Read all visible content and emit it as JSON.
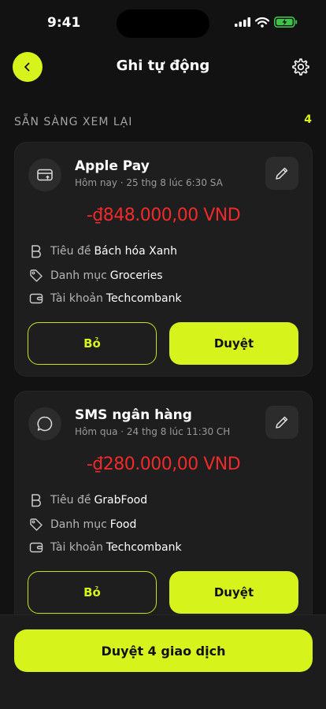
{
  "status_bar": {
    "time": "9:41"
  },
  "header": {
    "title": "Ghi tự động"
  },
  "section": {
    "title": "SẴN SÀNG XEM LẠI",
    "count": "4"
  },
  "labels": {
    "title": "Tiêu đề",
    "category": "Danh mục",
    "account": "Tài khoản",
    "skip": "Bỏ",
    "approve": "Duyệt"
  },
  "cards": [
    {
      "source": "Apple Pay",
      "date": "Hôm nay · 25 thg 8 lúc 6:30 SA",
      "amount": "-₫848.000,00 VND",
      "title": "Bách hóa Xanh",
      "category": "Groceries",
      "account": "Techcombank"
    },
    {
      "source": "SMS ngân hàng",
      "date": "Hôm qua · 24 thg 8 lúc 11:30 CH",
      "amount": "-₫280.000,00 VND",
      "title": "GrabFood",
      "category": "Food",
      "account": "Techcombank"
    }
  ],
  "footer": {
    "approve_all": "Duyệt 4 giao dịch"
  },
  "colors": {
    "accent": "#d6f31b",
    "negative": "#f02a2a",
    "background": "#121212",
    "card": "#1e1e1e"
  }
}
